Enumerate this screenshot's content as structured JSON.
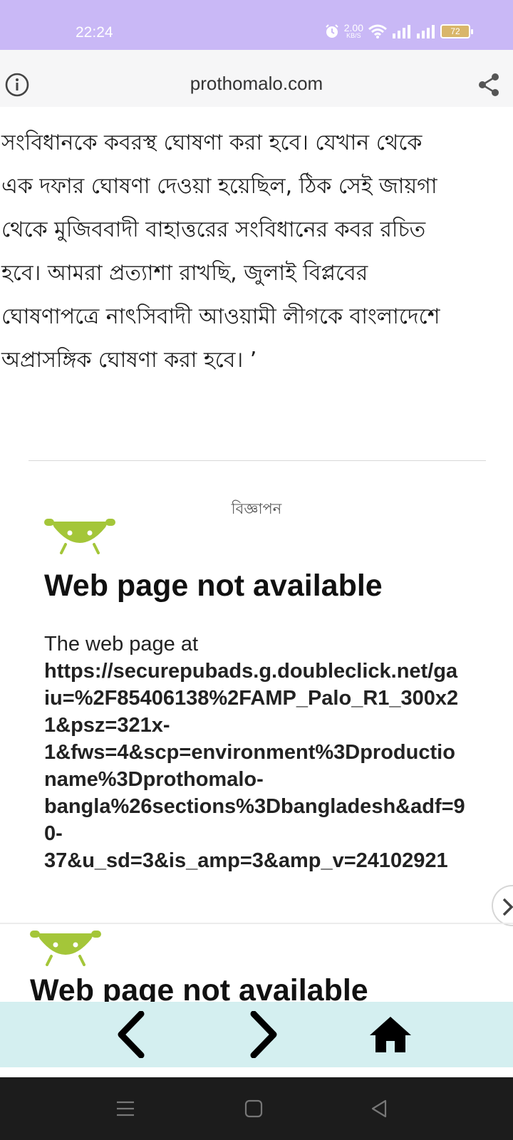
{
  "status_bar": {
    "time": "22:24",
    "net_speed_value": "2.00",
    "net_speed_unit": "KB/S",
    "battery": "72",
    "icons": [
      "alarm-icon",
      "wifi-icon",
      "signal-icon",
      "signal-icon",
      "battery-icon"
    ]
  },
  "browser": {
    "url": "prothomalo.com",
    "left_icon": "info-icon",
    "right_icon": "share-icon"
  },
  "article": {
    "lines": [
      "সংবিধানকে কবরস্থ ঘোষণা করা হবে। যেখান থেকে",
      "এক দফার ঘোষণা দেওয়া হয়েছিল, ঠিক সেই জায়গা",
      "থেকে মুজিববাদী বাহাত্তরের সংবিধানের কবর রচিত",
      "হবে। আমরা প্রত্যাশা রাখছি, জুলাই বিপ্লবের",
      "ঘোষণাপত্রে নাৎসিবাদী আওয়ামী লীগকে বাংলাদেশে",
      "অপ্রাসঙ্গিক ঘোষণা করা হবে। ’"
    ]
  },
  "ad": {
    "label": "বিজ্ঞাপন",
    "error_title": "Web page not available",
    "error_intro": "The web page at",
    "error_url_lines": [
      "https://securepubads.g.doubleclick.net/ga",
      "iu=%2F85406138%2FAMP_Palo_R1_300x2",
      "1&psz=321x-",
      "1&fws=4&scp=environment%3Dproductio",
      "name%3Dprothomalo-",
      "bangla%26sections%3Dbangladesh&adf=9",
      "0-",
      "37&u_sd=3&is_amp=3&amp_v=24102921"
    ],
    "second_error_title": "Web page not available"
  },
  "bottom_nav": {
    "icons": [
      "back-icon",
      "forward-icon",
      "home-icon"
    ]
  },
  "system_nav": {
    "icons": [
      "recents-icon",
      "home-square-icon",
      "back-triangle-icon"
    ]
  },
  "colors": {
    "status_bar": "#c9b8f6",
    "url_bar": "#f6f6f7",
    "bottom_nav": "#d4eff0",
    "android_green": "#a4c639",
    "system_nav": "#1c1c1c"
  }
}
